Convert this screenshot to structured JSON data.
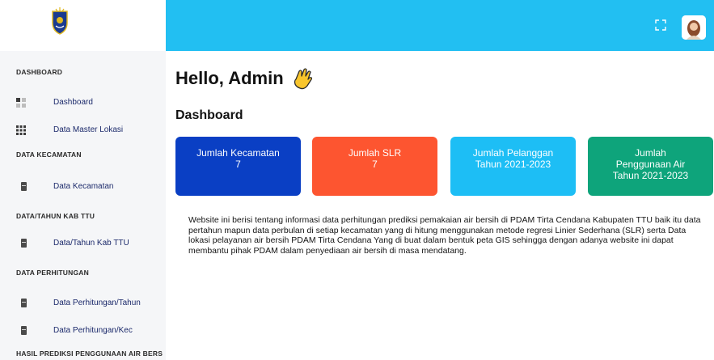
{
  "sidebar": {
    "sections": [
      {
        "title": "DASHBOARD",
        "items": [
          {
            "label": "Dashboard",
            "icon": "dashboard-grid-icon"
          },
          {
            "label": "Data Master Lokasi",
            "icon": "dots-grid-icon"
          }
        ]
      },
      {
        "title": "DATA KECAMATAN",
        "items": [
          {
            "label": "Data Kecamatan",
            "icon": "document-icon"
          }
        ]
      },
      {
        "title": "DATA/TAHUN KAB TTU",
        "items": [
          {
            "label": "Data/Tahun Kab TTU",
            "icon": "document-icon"
          }
        ]
      },
      {
        "title": "DATA PERHITUNGAN",
        "items": [
          {
            "label": "Data Perhitungan/Tahun",
            "icon": "document-icon"
          },
          {
            "label": "Data Perhitungan/Kec",
            "icon": "document-icon"
          }
        ]
      },
      {
        "title": "HASIL PREDIKSI PENGGUNAAN AIR BERS",
        "items": []
      }
    ]
  },
  "header": {
    "fullscreen_icon": "fullscreen-icon",
    "avatar_icon": "user-avatar-icon"
  },
  "main": {
    "greeting": "Hello, Admin",
    "title": "Dashboard",
    "cards": [
      {
        "line1": "Jumlah Kecamatan",
        "line2": "7",
        "line3": ""
      },
      {
        "line1": "Jumlah SLR",
        "line2": "7",
        "line3": ""
      },
      {
        "line1": "Jumlah Pelanggan",
        "line2": "Tahun 2021-2023",
        "line3": ""
      },
      {
        "line1": "Jumlah",
        "line2": "Penggunaan Air",
        "line3": "Tahun 2021-2023"
      }
    ],
    "description": "Website ini berisi tentang informasi data perhitungan prediksi pemakaian air bersih di PDAM Tirta Cendana Kabupaten TTU baik itu data pertahun mapun data perbulan di setiap kecamatan yang di hitung menggunakan metode regresi Linier Sederhana (SLR) serta Data lokasi pelayanan air bersih PDAM Tirta Cendana Yang di buat dalam bentuk peta GIS sehingga dengan adanya website ini dapat membantu pihak PDAM dalam penyediaan air bersih di masa mendatang."
  },
  "colors": {
    "topbar": "#22bff2",
    "card1": "#0a3fc4",
    "card2": "#fd5530",
    "card3": "#1dbef5",
    "card4": "#0ea47b",
    "nav_text": "#1c2a6b"
  }
}
